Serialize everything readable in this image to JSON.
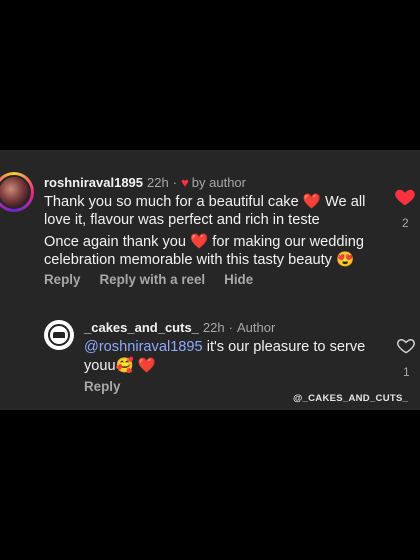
{
  "comment": {
    "username": "roshniraval1895",
    "time": "22h",
    "separator": "·",
    "liked_by": "by author",
    "line1": "Thank you so much for a beautiful cake",
    "line1b": " We all love it, flavour was perfect and rich in teste",
    "line2a": "Once again thank you ",
    "line2b": " for making our wedding celebration memorable with this tasty beauty ",
    "emoji_heart": "❤️",
    "emoji_heart_eyes": "😍",
    "like_count": "2",
    "actions": [
      "Reply",
      "Reply with a reel",
      "Hide"
    ]
  },
  "reply": {
    "username": "_cakes_and_cuts_",
    "time": "22h",
    "separator": "·",
    "role": "Author",
    "mention": "@roshniraval1895",
    "text": " it's our pleasure to serve youu",
    "emoji_love": "🥰",
    "emoji_heart": "❤️",
    "like_count": "1",
    "action": "Reply"
  },
  "watermark": "@_CAKES_AND_CUTS_",
  "colors": {
    "panel": "#262626",
    "heart": "#ff3040",
    "mention": "#8fa9ff",
    "muted": "#a8a8a8"
  }
}
